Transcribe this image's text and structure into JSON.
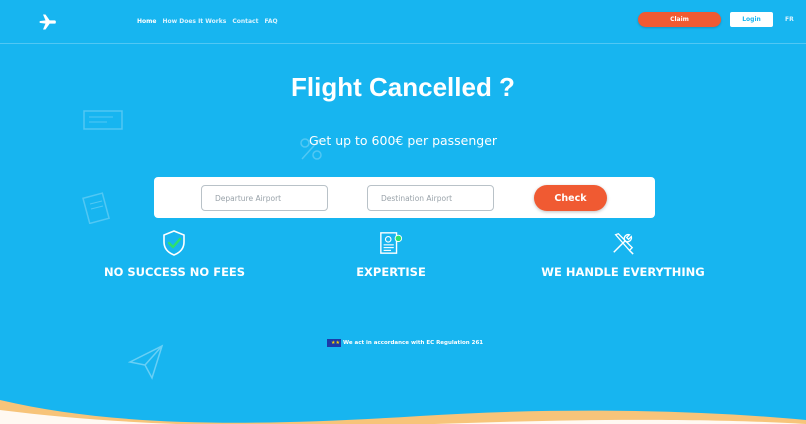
{
  "nav": {
    "items": [
      "Home",
      "How Does It Works",
      "Contact",
      "FAQ"
    ],
    "claim_label": "Claim",
    "login_label": "Login",
    "lang_label": "FR"
  },
  "hero": {
    "title": "Flight Cancelled ?",
    "subtitle": "Get up to 600€ per passenger"
  },
  "search": {
    "departure_placeholder": "Departure Airport",
    "destination_placeholder": "Destination Airport",
    "check_label": "Check"
  },
  "features": [
    {
      "icon": "shield-check-icon",
      "label": "NO SUCCESS NO FEES"
    },
    {
      "icon": "certificate-icon",
      "label": "EXPERTISE"
    },
    {
      "icon": "tools-icon",
      "label": "WE HANDLE EVERYTHING"
    }
  ],
  "regulation": {
    "text": "We act in accordance with EC Regulation 261"
  },
  "colors": {
    "background": "#17b5f0",
    "accent": "#f05a32",
    "white": "#ffffff",
    "wave": "#f7c47a"
  }
}
